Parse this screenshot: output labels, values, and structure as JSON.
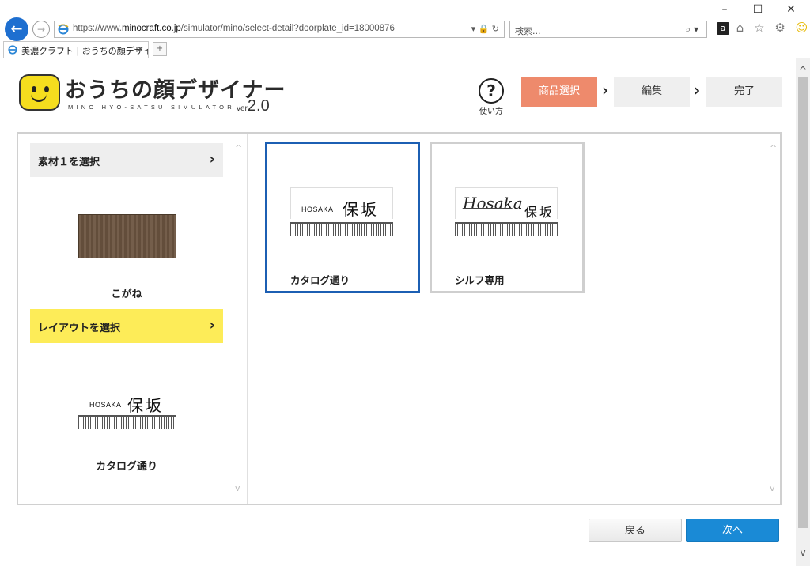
{
  "browser": {
    "url_prefix": "https://www.",
    "url_domain": "minocraft.co.jp",
    "url_path": "/simulator/mino/select-detail?doorplate_id=18000876",
    "url_actions": "▾ 🔒 ↻",
    "search_placeholder": "検索...",
    "search_icon": "⌕ ▾",
    "tab_title": "美濃クラフト | おうちの顔デザイ...",
    "tab_close": "✕",
    "new_tab": "+",
    "win_minimize": "–",
    "win_maximize": "☐",
    "win_close": "✕",
    "back_glyph": "←",
    "fwd_glyph": "→",
    "toolbar_amazon": "a",
    "toolbar_home": "⌂",
    "toolbar_star": "☆",
    "toolbar_gear": "⚙",
    "toolbar_smile": "☺"
  },
  "header": {
    "logo_title": "おうちの顔デザイナー",
    "logo_subtitle": "MINO HYO-SATSU SIMULATOR",
    "logo_ver_prefix": "ver",
    "logo_ver_number": "2.0",
    "help_glyph": "?",
    "help_label": "使い方",
    "steps": [
      "商品選択",
      "編集",
      "完了"
    ],
    "step_arrow": "›",
    "active_step": 0
  },
  "left_panel": {
    "material_heading": "素材１を選択",
    "material_name": "こがね",
    "layout_heading": "レイアウトを選択",
    "layout_name": "カタログ通り",
    "chevron": "›",
    "scroll_up": "^",
    "scroll_down": "v"
  },
  "preview_plate": {
    "roman": "HOSAKA",
    "kanji": "保坂"
  },
  "layouts": [
    {
      "name": "カタログ通り",
      "selected": true,
      "roman": "HOSAKA",
      "kanji": "保坂"
    },
    {
      "name": "シルフ専用",
      "selected": false,
      "script": "Hosaka",
      "kanji": "保坂"
    }
  ],
  "buttons": {
    "back": "戻る",
    "next": "次へ"
  },
  "colors": {
    "active_step": "#ee8a6c",
    "layout_heading_bg": "#fdec58",
    "selected_border": "#1c5fb3",
    "next_button": "#1a8ad6",
    "logo_yellow": "#f5dd1e",
    "browser_back": "#1e6fd0"
  },
  "icons": {
    "back": "arrow-left-icon",
    "forward": "arrow-right-icon",
    "help": "question-circle-icon",
    "chevron": "chevron-right-icon"
  }
}
